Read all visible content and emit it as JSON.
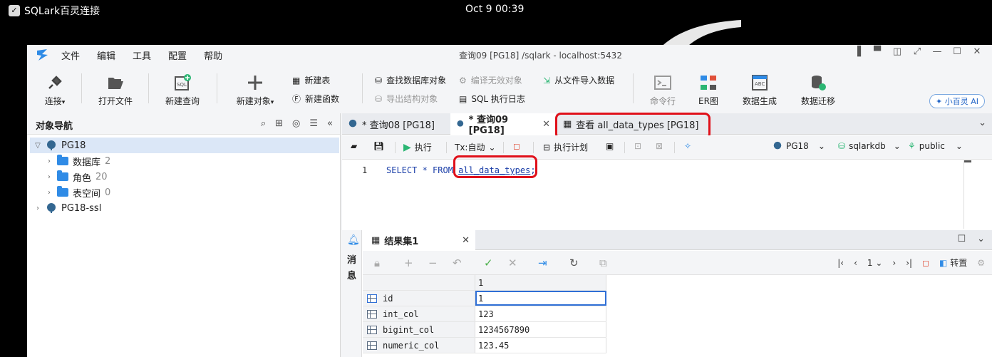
{
  "desktop": {
    "app_name": "SQLark百灵连接",
    "clock": "Oct 9  00:39"
  },
  "window": {
    "title": "查询09 [PG18] /sqlark  - localhost:5432",
    "menu": [
      "文件",
      "编辑",
      "工具",
      "配置",
      "帮助"
    ]
  },
  "toolbar": {
    "connect": "连接",
    "open_file": "打开文件",
    "new_query": "新建查询",
    "new_object": "新建对象",
    "new_table": "新建表",
    "new_function": "新建函数",
    "find_db_object": "查找数据库对象",
    "export_structure": "导出结构对象",
    "compile_invalid": "编译无效对象",
    "sql_log": "SQL 执行日志",
    "import_from_file": "从文件导入数据",
    "command_line": "命令行",
    "er_diagram": "ER图",
    "data_generation": "数据生成",
    "data_migration": "数据迁移",
    "ai_button": "小百灵 AI"
  },
  "navigator": {
    "title": "对象导航",
    "tree": [
      {
        "label": "PG18"
      },
      {
        "label": "数据库",
        "count": "2"
      },
      {
        "label": "角色",
        "count": "20"
      },
      {
        "label": "表空间",
        "count": "0"
      },
      {
        "label": "PG18-ssl"
      }
    ]
  },
  "tabs": [
    {
      "label": "* 查询08 [PG18]"
    },
    {
      "label": "* 查询09 [PG18]"
    },
    {
      "label": "查看 all_data_types [PG18]"
    }
  ],
  "editor_toolbar": {
    "execute": "执行",
    "tx_mode": "Tx:自动",
    "explain": "执行计划",
    "connection": "PG18",
    "database": "sqlarkdb",
    "schema": "public"
  },
  "editor": {
    "line_number": "1",
    "sql_prefix": "SELECT * FROM ",
    "sql_table": "all_data_types",
    "sql_suffix": ";"
  },
  "results": {
    "messages_label": "消息",
    "tab_label": "结果集1",
    "page_number": "1",
    "transpose_label": "转置",
    "column_header": "1",
    "rows": [
      {
        "name": "id",
        "value": "1"
      },
      {
        "name": "int_col",
        "value": "123"
      },
      {
        "name": "bigint_col",
        "value": "1234567890"
      },
      {
        "name": "numeric_col",
        "value": "123.45"
      }
    ]
  },
  "colors": {
    "highlight": "#e0101a",
    "accent": "#2f8be6",
    "selection": "#dbe7f7"
  }
}
